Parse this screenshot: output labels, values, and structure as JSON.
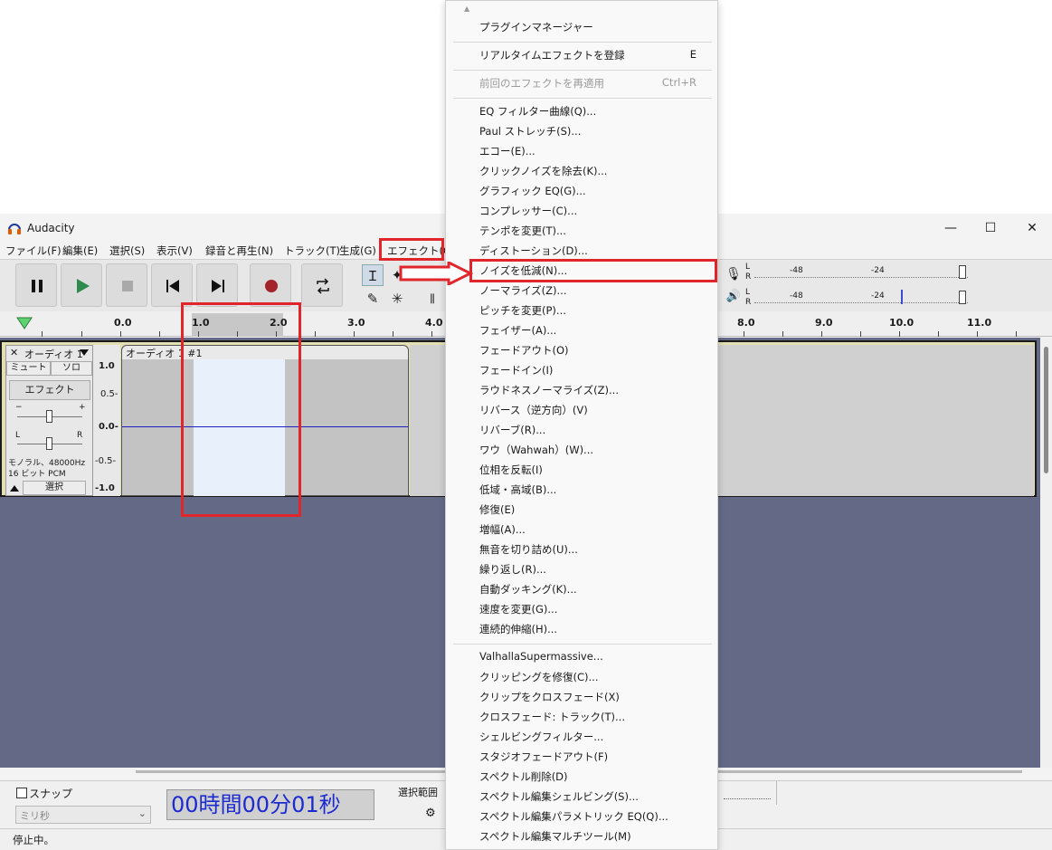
{
  "window": {
    "title": "Audacity",
    "minimize": "—",
    "maximize": "☐",
    "close": "✕"
  },
  "menubar": [
    "ファイル(F)",
    "編集(E)",
    "選択(S)",
    "表示(V)",
    "録音と再生(N)",
    "トラック(T)",
    "生成(G)",
    "エフェクト(C)"
  ],
  "ruler": {
    "labels": [
      "0.0",
      "1.0",
      "2.0",
      "3.0",
      "4.0",
      "8.0",
      "9.0",
      "10.0",
      "11.0"
    ]
  },
  "meters": {
    "scale_a": "-48",
    "scale_b": "-24",
    "lr_l": "L",
    "lr_r": "R"
  },
  "track": {
    "name": "オーディオ 1",
    "close": "✕",
    "mute": "ミュート",
    "solo": "ソロ",
    "effects": "エフェクト",
    "gain_minus": "−",
    "gain_plus": "+",
    "pan_l": "L",
    "pan_r": "R",
    "info1": "モノラル、48000Hz",
    "info2": "16 ビット PCM",
    "select": "選択",
    "vscale": [
      "1.0",
      "0.5-",
      "0.0-",
      "-0.5-",
      "-1.0"
    ],
    "clip_name": "オーディオ 1 #1"
  },
  "bottom": {
    "snap_label": "スナップ",
    "snap_unit": "ミリ秒",
    "time": "00時間00分01秒",
    "selection_label": "選択範囲",
    "status": "停止中。"
  },
  "dropdown": {
    "top_arrow": "▲",
    "items": [
      {
        "label": "プラグインマネージャー",
        "shortcut": ""
      },
      {
        "label": "リアルタイムエフェクトを登録",
        "shortcut": "E"
      },
      {
        "label": "前回のエフェクトを再適用",
        "shortcut": "Ctrl+R",
        "disabled": true
      },
      {
        "label": "EQ フィルター曲線(Q)...",
        "shortcut": ""
      },
      {
        "label": "Paul ストレッチ(S)...",
        "shortcut": ""
      },
      {
        "label": "エコー(E)...",
        "shortcut": ""
      },
      {
        "label": "クリックノイズを除去(K)...",
        "shortcut": ""
      },
      {
        "label": "グラフィック EQ(G)...",
        "shortcut": ""
      },
      {
        "label": "コンプレッサー(C)...",
        "shortcut": ""
      },
      {
        "label": "テンポを変更(T)...",
        "shortcut": ""
      },
      {
        "label": "ディストーション(D)...",
        "shortcut": ""
      },
      {
        "label": "ノイズを低減(N)...",
        "shortcut": ""
      },
      {
        "label": "ノーマライズ(Z)...",
        "shortcut": ""
      },
      {
        "label": "ピッチを変更(P)...",
        "shortcut": ""
      },
      {
        "label": "フェイザー(A)...",
        "shortcut": ""
      },
      {
        "label": "フェードアウト(O)",
        "shortcut": ""
      },
      {
        "label": "フェードイン(I)",
        "shortcut": ""
      },
      {
        "label": "ラウドネスノーマライズ(Z)...",
        "shortcut": ""
      },
      {
        "label": "リバース（逆方向）(V)",
        "shortcut": ""
      },
      {
        "label": "リバーブ(R)...",
        "shortcut": ""
      },
      {
        "label": "ワウ（Wahwah）(W)...",
        "shortcut": ""
      },
      {
        "label": "位相を反転(I)",
        "shortcut": ""
      },
      {
        "label": "低域・高域(B)...",
        "shortcut": ""
      },
      {
        "label": "修復(E)",
        "shortcut": ""
      },
      {
        "label": "増幅(A)...",
        "shortcut": ""
      },
      {
        "label": "無音を切り詰め(U)...",
        "shortcut": ""
      },
      {
        "label": "繰り返し(R)...",
        "shortcut": ""
      },
      {
        "label": "自動ダッキング(K)...",
        "shortcut": ""
      },
      {
        "label": "速度を変更(G)...",
        "shortcut": ""
      },
      {
        "label": "連続的伸縮(H)...",
        "shortcut": ""
      },
      {
        "label": "ValhallaSupermassive...",
        "shortcut": ""
      },
      {
        "label": "クリッピングを修復(C)...",
        "shortcut": ""
      },
      {
        "label": "クリップをクロスフェード(X)",
        "shortcut": ""
      },
      {
        "label": "クロスフェード: トラック(T)...",
        "shortcut": ""
      },
      {
        "label": "シェルビングフィルター...",
        "shortcut": ""
      },
      {
        "label": "スタジオフェードアウト(F)",
        "shortcut": ""
      },
      {
        "label": "スペクトル削除(D)",
        "shortcut": ""
      },
      {
        "label": "スペクトル編集シェルビング(S)...",
        "shortcut": ""
      },
      {
        "label": "スペクトル編集パラメトリック EQ(Q)...",
        "shortcut": ""
      },
      {
        "label": "スペクトル編集マルチツール(M)",
        "shortcut": ""
      }
    ]
  },
  "colors": {
    "accent_red": "#e0262b",
    "track_bg": "#646a86",
    "selection": "#e7f0fb",
    "time_text": "#1c2bd0"
  }
}
